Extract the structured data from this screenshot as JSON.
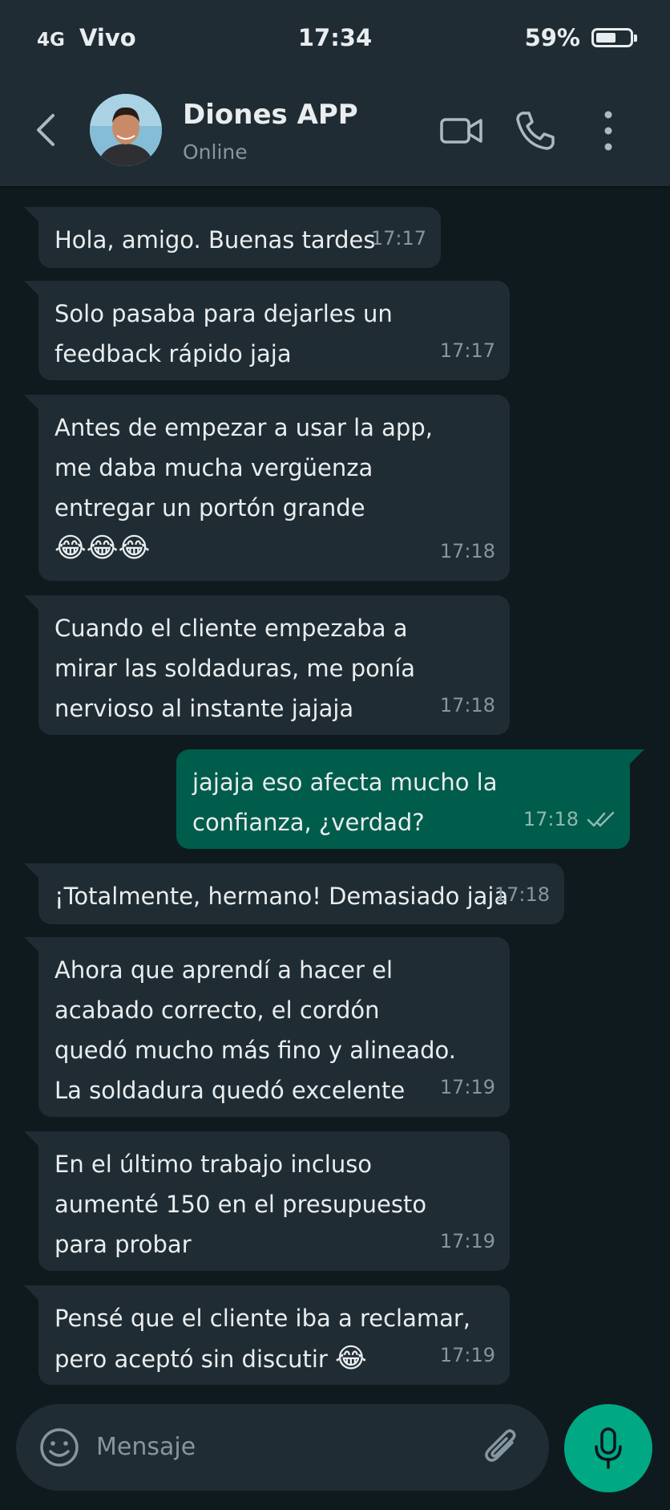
{
  "status_bar": {
    "network": "4G",
    "carrier": "Vivo",
    "time": "17:34",
    "battery": "59%",
    "battery_level": 0.59
  },
  "header": {
    "name": "Diones APP",
    "status": "Online",
    "icons": [
      "back-arrow-icon",
      "video-call-icon",
      "phone-icon",
      "more-vert-icon"
    ]
  },
  "messages": [
    {
      "dir": "in",
      "text": "Hola, amigo. Buenas tardes",
      "time": "17:17"
    },
    {
      "dir": "in",
      "text": "Solo pasaba para dejarles un\nfeedback rápido jaja",
      "time": "17:17"
    },
    {
      "dir": "in",
      "text": "Antes de empezar a usar la app,\nme daba mucha vergüenza\nentregar un portón grande",
      "emoji": "😂😂😂",
      "time": "17:18"
    },
    {
      "dir": "in",
      "text": "Cuando el cliente empezaba a\nmirar las soldaduras, me ponía\nnervioso al instante jajaja",
      "time": "17:18"
    },
    {
      "dir": "out",
      "text": "jajaja eso afecta mucho la\nconfianza, ¿verdad?",
      "time": "17:18",
      "read": true
    },
    {
      "dir": "in",
      "text": "¡Totalmente, hermano! Demasiado jaja",
      "time": "17:18"
    },
    {
      "dir": "in",
      "text": "Ahora que aprendí a hacer el\nacabado correcto, el cordón\nquedó mucho más fino y alineado.\nLa soldadura quedó excelente",
      "time": "17:19"
    },
    {
      "dir": "in",
      "text": "En el último trabajo incluso\naumenté 150 en el presupuesto\npara probar",
      "time": "17:19"
    },
    {
      "dir": "in",
      "text": "Pensé que el cliente iba a reclamar,\npero aceptó sin discutir",
      "emoji": "😂",
      "time": "17:19"
    }
  ],
  "composer": {
    "placeholder": "Mensaje",
    "icons": [
      "emoji-icon",
      "attach-icon",
      "mic-icon"
    ]
  },
  "colors": {
    "background": "#0f1a1f",
    "bar": "#1f2c33",
    "incoming": "#1f2c33",
    "outgoing": "#005c4b",
    "accent": "#00a884"
  }
}
